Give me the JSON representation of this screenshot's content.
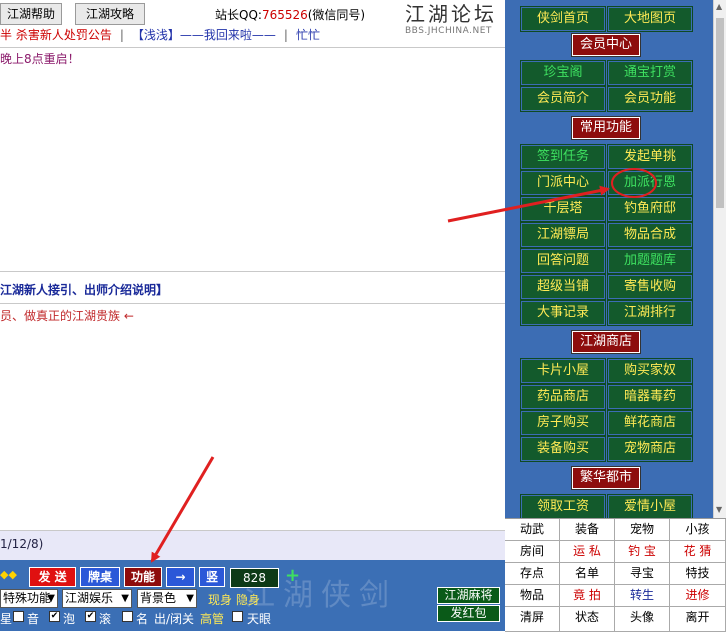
{
  "top": {
    "help_btn": "江湖帮助",
    "guide_btn": "江湖攻略",
    "qq_label": "站长QQ:",
    "qq_number": "765526",
    "qq_note": "(微信同号)",
    "logo_text": "江湖论坛",
    "logo_url": "BBS.JHCHINA.NET"
  },
  "notice": {
    "text1": "半 杀害新人处罚公告",
    "sep": "|",
    "text2": "【浅浅】——我回来啦——",
    "text3": "忙忙"
  },
  "chat": {
    "public_msg": "晚上8点重启！",
    "private_header": "江湖新人接引、出师介绍说明】",
    "private_msg": "员、做真正的江湖贵族 ←",
    "input_text": "1/12/8)"
  },
  "controls": {
    "send": "发 送",
    "table": "牌桌",
    "function": "功能",
    "arrow": "→",
    "vertical": "竖",
    "count": "828",
    "plus": "+",
    "select1": "特殊功能",
    "select2": "江湖娱乐",
    "select3": "背景色",
    "show": "现身",
    "hide": "隐身",
    "watermark": "江湖侠剑",
    "mahjong": "江湖麻将",
    "red_packet": "发红包",
    "cb1_label": "音",
    "cb2_label": "泡",
    "cb3_label": "滚",
    "cb4_label": "名",
    "cb5_label": "出/闭关",
    "gaoqing": "高管",
    "cb6_label": "天眼",
    "cb0_label": "星",
    "check_mark": "✔"
  },
  "sidebar": {
    "row1": [
      "侠剑首页",
      "大地图页"
    ],
    "hdr_member": "会员中心",
    "row2": [
      "珍宝阁",
      "通宝打赏"
    ],
    "row3": [
      "会员简介",
      "会员功能"
    ],
    "hdr_common": "常用功能",
    "row4": [
      "签到任务",
      "发起单挑"
    ],
    "row5": [
      "门派中心",
      "加派行恩"
    ],
    "row6": [
      "千层塔",
      "钓鱼府邸"
    ],
    "row7": [
      "江湖镖局",
      "物品合成"
    ],
    "row8": [
      "回答问题",
      "加题题库"
    ],
    "row9": [
      "超级当铺",
      "寄售收购"
    ],
    "row10": [
      "大事记录",
      "江湖排行"
    ],
    "hdr_shop": "江湖商店",
    "row11": [
      "卡片小屋",
      "购买家奴"
    ],
    "row12": [
      "药品商店",
      "暗器毒药"
    ],
    "row13": [
      "房子购买",
      "鲜花商店"
    ],
    "row14": [
      "装备购买",
      "宠物商店"
    ],
    "hdr_city": "繁华都市",
    "row15": [
      "领取工资",
      "爱情小屋"
    ]
  },
  "grid": {
    "cells": [
      [
        "动武",
        "装备",
        "宠物",
        "小孩"
      ],
      [
        "房间",
        "运 私",
        "钓 宝",
        "花 猜"
      ],
      [
        "存点",
        "名单",
        "寻宝",
        "特技"
      ],
      [
        "物品",
        "竟 拍",
        "转生",
        "进修"
      ],
      [
        "清屏",
        "状态",
        "头像",
        "离开"
      ]
    ]
  },
  "colors": {
    "sidebar_bg": "#3c6db4",
    "btn_green": "#135a2c",
    "header_red": "#8d0d0d",
    "link_yellow": "#ffea55",
    "link_green": "#3ee060",
    "annotation_red": "#e02020"
  }
}
